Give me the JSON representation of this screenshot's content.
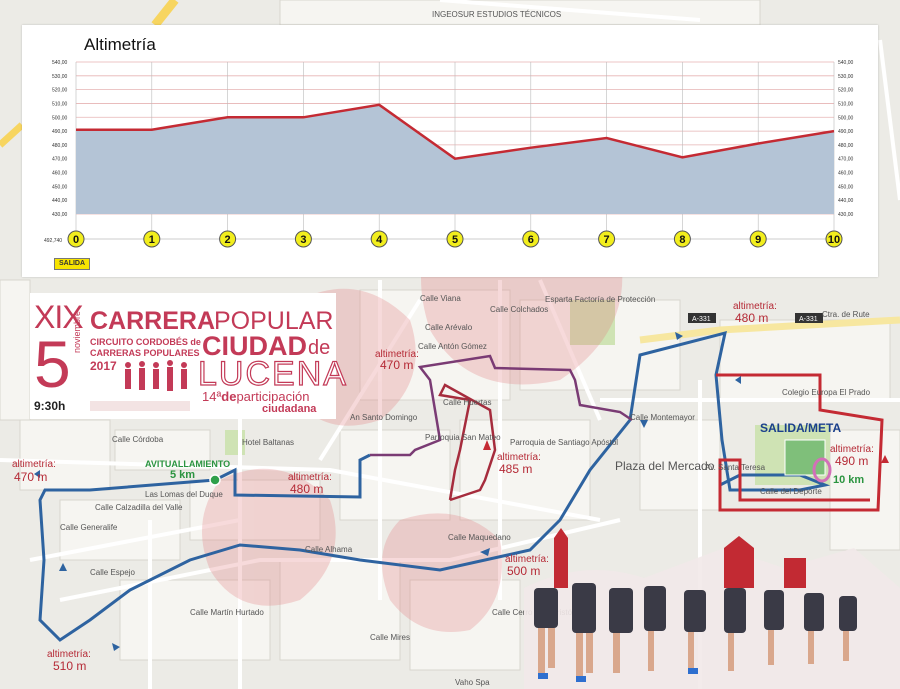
{
  "elevation": {
    "title": "Altimetría",
    "start_tag": "SALIDA",
    "axis_value_left": "492,740",
    "y_ticks": [
      "430,00",
      "440,00",
      "450,00",
      "460,00",
      "470,00",
      "480,00",
      "490,00",
      "500,00",
      "510,00",
      "520,00",
      "530,00",
      "540,00"
    ]
  },
  "chart_data": {
    "type": "area",
    "title": "Altimetría",
    "x": [
      0,
      1,
      2,
      3,
      4,
      5,
      6,
      7,
      8,
      9,
      10
    ],
    "categories": [
      "0",
      "1",
      "2",
      "3",
      "4",
      "5",
      "6",
      "7",
      "8",
      "9",
      "10"
    ],
    "values": [
      491,
      491,
      500,
      500,
      509,
      470,
      478,
      485,
      471,
      481,
      490
    ],
    "ylim": [
      430,
      540
    ],
    "grid": true,
    "colors": {
      "line": "#c42a33",
      "fill": "#b4c4d6",
      "marker": "#f2ee1d"
    }
  },
  "logo": {
    "numeral": "XIX",
    "line1a": "CARRERA",
    "line1b": "POPULAR",
    "day": "5",
    "month": "noviembre",
    "circuit1": "CIRCUITO CORDOBÉS de",
    "circuit2": "CARRERAS POPULARES",
    "year": "2017",
    "city1": "CIUDAD",
    "city_de": "de",
    "city2": "LUCENA",
    "time": "9:30h",
    "part1": "14ª",
    "part2": "de",
    "part3": "participación",
    "part4": "ciudadana"
  },
  "map": {
    "start_finish": "SALIDA/META",
    "finish_km": "10 km",
    "aid_station": "AVITUALLAMIENTO",
    "aid_km": "5 km",
    "alti_label": "altimetría:",
    "altitudes": [
      "470 m",
      "470 m",
      "480 m",
      "485 m",
      "480 m",
      "490 m",
      "500 m",
      "510 m"
    ],
    "route_badge": "A-331",
    "route_badge2": "A-331",
    "streets": [
      "INGEOSUR ESTUDIOS TÉCNICOS",
      "Calle Viana",
      "Calle Arévalo",
      "Calle Colchados",
      "Esparta Factoría de Protección",
      "Calle Antón Gómez",
      "Calle Huertas",
      "Parroquia San Mateo",
      "Parroquia de Santiago Apóstol",
      "An Santo Domingo",
      "Calle Córdoba",
      "Hotel Baltanas",
      "Las Lomas del Duque",
      "Calle Calzadilla del Valle",
      "Calle Generalife",
      "Calle Martín Hurtado",
      "Calle Alhama",
      "Calle Maquedano",
      "Plaza del Mercado",
      "Av. Santa Teresa",
      "Calle Montemayor",
      "Calle del Deporte",
      "Colegio Europa El Prado",
      "Ctra. de Rute",
      "Calle Espejo",
      "Calle Cerro San Cristóbal",
      "Calle Mires",
      "Vaho Spa"
    ]
  }
}
